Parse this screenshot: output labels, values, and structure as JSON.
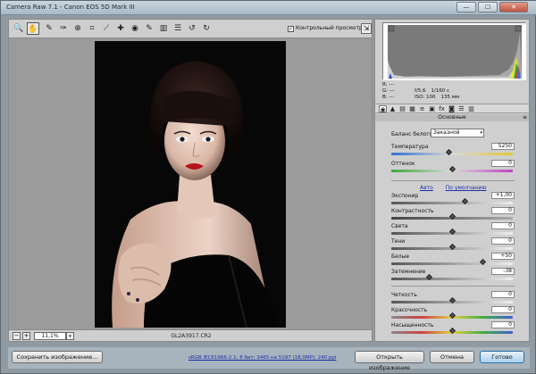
{
  "window": {
    "title": "Camera Raw 7.1  -  Canon EOS 5D Mark III",
    "minimize_glyph": "—",
    "maximize_glyph": "☐",
    "close_glyph": "✕"
  },
  "toolbar": {
    "tools": [
      {
        "name": "zoom-tool",
        "glyph": "🔍"
      },
      {
        "name": "hand-tool",
        "glyph": "✋"
      },
      {
        "name": "white-balance-tool",
        "glyph": "✎"
      },
      {
        "name": "color-sampler-tool",
        "glyph": "✑"
      },
      {
        "name": "targeted-adjustment-tool",
        "glyph": "⊕"
      },
      {
        "name": "crop-tool",
        "glyph": "⌗"
      },
      {
        "name": "straighten-tool",
        "glyph": "⟋"
      },
      {
        "name": "spot-removal-tool",
        "glyph": "✚"
      },
      {
        "name": "red-eye-tool",
        "glyph": "◉"
      },
      {
        "name": "adjustment-brush-tool",
        "glyph": "✎"
      },
      {
        "name": "graduated-filter-tool",
        "glyph": "▥"
      },
      {
        "name": "open-preferences",
        "glyph": "☰"
      },
      {
        "name": "rotate-left",
        "glyph": "↺"
      },
      {
        "name": "rotate-right",
        "glyph": "↻"
      }
    ],
    "preview_label": "Контрольный просмотр",
    "preview_checked": "✓",
    "fullscreen_glyph": "⇲"
  },
  "status": {
    "zoom_out": "−",
    "zoom_in": "+",
    "zoom_value": "11,1%",
    "zoom_arrow": "▾",
    "filename": "GL2A3917.CR2"
  },
  "info": {
    "r": "R:  ---",
    "g": "G:  ---",
    "b": "B:  ---",
    "aperture": "f/5,6",
    "shutter": "1/160 с",
    "iso": "ISO: 100",
    "focal": "135 мм"
  },
  "panel": {
    "tabs": [
      "◉",
      "▲",
      "▤",
      "▦",
      "≡",
      "▣",
      "fx",
      "◙",
      "☰",
      "▥"
    ],
    "section_title": "Основные",
    "section_menu": "≡",
    "wb_label": "Баланс белого:",
    "wb_value": "Заказной",
    "wb_arrow": "▾",
    "auto_link": "Авто",
    "default_link": "По умолчанию",
    "sliders": {
      "temperature": {
        "label": "Температура",
        "value": "5250",
        "pos": 0.47
      },
      "tint": {
        "label": "Оттенок",
        "value": "0",
        "pos": 0.5
      },
      "exposure": {
        "label": "Экспонир",
        "value": "+1,00",
        "pos": 0.6
      },
      "contrast": {
        "label": "Контрастность",
        "value": "0",
        "pos": 0.5
      },
      "highlights": {
        "label": "Света",
        "value": "0",
        "pos": 0.5
      },
      "shadows": {
        "label": "Тени",
        "value": "0",
        "pos": 0.5
      },
      "whites": {
        "label": "Белые",
        "value": "+50",
        "pos": 0.75
      },
      "blacks": {
        "label": "Затемнение",
        "value": "-38",
        "pos": 0.31
      },
      "clarity": {
        "label": "Четкость",
        "value": "0",
        "pos": 0.5
      },
      "vibrance": {
        "label": "Красочность",
        "value": "0",
        "pos": 0.5
      },
      "saturation": {
        "label": "Насыщенность",
        "value": "0",
        "pos": 0.5
      }
    }
  },
  "bottom": {
    "save_label": "Сохранить изображение...",
    "workflow_link": "sRGB IEC61966-2.1; 8 бит; 3465 на 5197 (18,0МР); 240 ppi",
    "open_label": "Открыть изображение",
    "cancel_label": "Отмена",
    "done_label": "Готово"
  }
}
